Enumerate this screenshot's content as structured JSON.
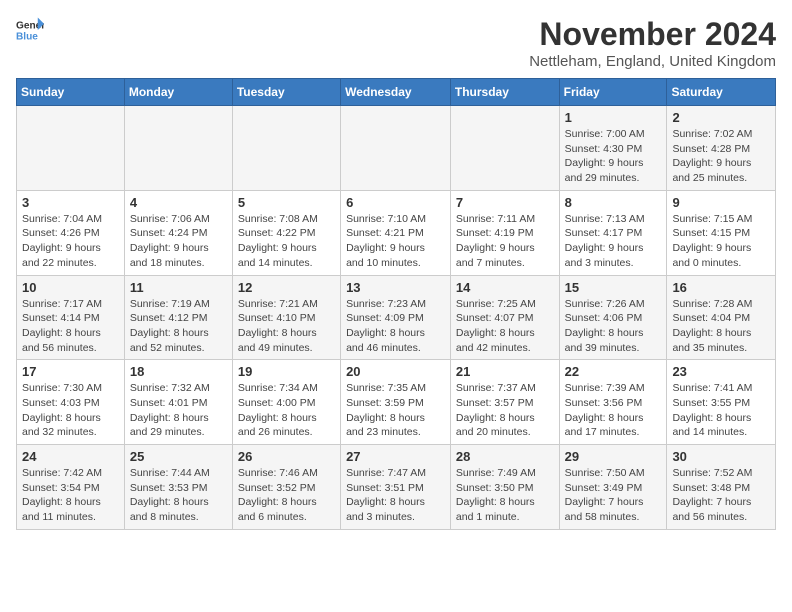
{
  "logo": {
    "text_general": "General",
    "text_blue": "Blue"
  },
  "title": "November 2024",
  "subtitle": "Nettleham, England, United Kingdom",
  "days_of_week": [
    "Sunday",
    "Monday",
    "Tuesday",
    "Wednesday",
    "Thursday",
    "Friday",
    "Saturday"
  ],
  "weeks": [
    [
      {
        "day": "",
        "info": ""
      },
      {
        "day": "",
        "info": ""
      },
      {
        "day": "",
        "info": ""
      },
      {
        "day": "",
        "info": ""
      },
      {
        "day": "",
        "info": ""
      },
      {
        "day": "1",
        "info": "Sunrise: 7:00 AM\nSunset: 4:30 PM\nDaylight: 9 hours and 29 minutes."
      },
      {
        "day": "2",
        "info": "Sunrise: 7:02 AM\nSunset: 4:28 PM\nDaylight: 9 hours and 25 minutes."
      }
    ],
    [
      {
        "day": "3",
        "info": "Sunrise: 7:04 AM\nSunset: 4:26 PM\nDaylight: 9 hours and 22 minutes."
      },
      {
        "day": "4",
        "info": "Sunrise: 7:06 AM\nSunset: 4:24 PM\nDaylight: 9 hours and 18 minutes."
      },
      {
        "day": "5",
        "info": "Sunrise: 7:08 AM\nSunset: 4:22 PM\nDaylight: 9 hours and 14 minutes."
      },
      {
        "day": "6",
        "info": "Sunrise: 7:10 AM\nSunset: 4:21 PM\nDaylight: 9 hours and 10 minutes."
      },
      {
        "day": "7",
        "info": "Sunrise: 7:11 AM\nSunset: 4:19 PM\nDaylight: 9 hours and 7 minutes."
      },
      {
        "day": "8",
        "info": "Sunrise: 7:13 AM\nSunset: 4:17 PM\nDaylight: 9 hours and 3 minutes."
      },
      {
        "day": "9",
        "info": "Sunrise: 7:15 AM\nSunset: 4:15 PM\nDaylight: 9 hours and 0 minutes."
      }
    ],
    [
      {
        "day": "10",
        "info": "Sunrise: 7:17 AM\nSunset: 4:14 PM\nDaylight: 8 hours and 56 minutes."
      },
      {
        "day": "11",
        "info": "Sunrise: 7:19 AM\nSunset: 4:12 PM\nDaylight: 8 hours and 52 minutes."
      },
      {
        "day": "12",
        "info": "Sunrise: 7:21 AM\nSunset: 4:10 PM\nDaylight: 8 hours and 49 minutes."
      },
      {
        "day": "13",
        "info": "Sunrise: 7:23 AM\nSunset: 4:09 PM\nDaylight: 8 hours and 46 minutes."
      },
      {
        "day": "14",
        "info": "Sunrise: 7:25 AM\nSunset: 4:07 PM\nDaylight: 8 hours and 42 minutes."
      },
      {
        "day": "15",
        "info": "Sunrise: 7:26 AM\nSunset: 4:06 PM\nDaylight: 8 hours and 39 minutes."
      },
      {
        "day": "16",
        "info": "Sunrise: 7:28 AM\nSunset: 4:04 PM\nDaylight: 8 hours and 35 minutes."
      }
    ],
    [
      {
        "day": "17",
        "info": "Sunrise: 7:30 AM\nSunset: 4:03 PM\nDaylight: 8 hours and 32 minutes."
      },
      {
        "day": "18",
        "info": "Sunrise: 7:32 AM\nSunset: 4:01 PM\nDaylight: 8 hours and 29 minutes."
      },
      {
        "day": "19",
        "info": "Sunrise: 7:34 AM\nSunset: 4:00 PM\nDaylight: 8 hours and 26 minutes."
      },
      {
        "day": "20",
        "info": "Sunrise: 7:35 AM\nSunset: 3:59 PM\nDaylight: 8 hours and 23 minutes."
      },
      {
        "day": "21",
        "info": "Sunrise: 7:37 AM\nSunset: 3:57 PM\nDaylight: 8 hours and 20 minutes."
      },
      {
        "day": "22",
        "info": "Sunrise: 7:39 AM\nSunset: 3:56 PM\nDaylight: 8 hours and 17 minutes."
      },
      {
        "day": "23",
        "info": "Sunrise: 7:41 AM\nSunset: 3:55 PM\nDaylight: 8 hours and 14 minutes."
      }
    ],
    [
      {
        "day": "24",
        "info": "Sunrise: 7:42 AM\nSunset: 3:54 PM\nDaylight: 8 hours and 11 minutes."
      },
      {
        "day": "25",
        "info": "Sunrise: 7:44 AM\nSunset: 3:53 PM\nDaylight: 8 hours and 8 minutes."
      },
      {
        "day": "26",
        "info": "Sunrise: 7:46 AM\nSunset: 3:52 PM\nDaylight: 8 hours and 6 minutes."
      },
      {
        "day": "27",
        "info": "Sunrise: 7:47 AM\nSunset: 3:51 PM\nDaylight: 8 hours and 3 minutes."
      },
      {
        "day": "28",
        "info": "Sunrise: 7:49 AM\nSunset: 3:50 PM\nDaylight: 8 hours and 1 minute."
      },
      {
        "day": "29",
        "info": "Sunrise: 7:50 AM\nSunset: 3:49 PM\nDaylight: 7 hours and 58 minutes."
      },
      {
        "day": "30",
        "info": "Sunrise: 7:52 AM\nSunset: 3:48 PM\nDaylight: 7 hours and 56 minutes."
      }
    ]
  ]
}
